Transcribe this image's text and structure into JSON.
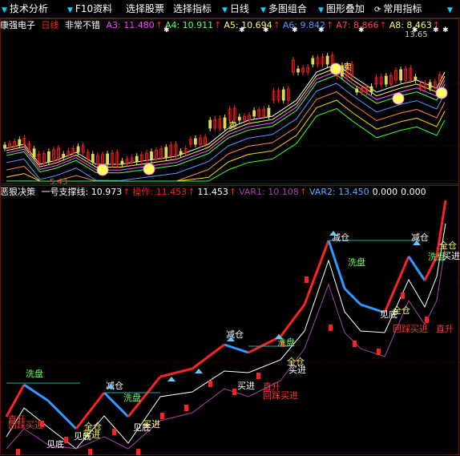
{
  "menubar": {
    "items": [
      {
        "label": "技术分析",
        "arrow": true
      },
      {
        "label": "F10资料",
        "arrow": true
      },
      {
        "label": "选择股票",
        "arrow": false
      },
      {
        "label": "选择指标",
        "arrow": false
      },
      {
        "label": "日线",
        "arrow": true
      },
      {
        "label": "多图组合",
        "arrow": true
      },
      {
        "label": "图形叠加",
        "arrow": true
      },
      {
        "label": "常用指标",
        "arrow": false,
        "icon": "refresh-icon"
      }
    ],
    "trailing_arrow": "▼"
  },
  "panel1": {
    "stock_name": "康强电子",
    "period": "日线",
    "comment": "非常不错",
    "indicators": [
      {
        "label": "A3: 11.480",
        "color": "#ff44ff"
      },
      {
        "label": "A4: 10.911",
        "color": "#66ff66"
      },
      {
        "label": "A5: 10.694",
        "color": "#ffff66"
      },
      {
        "label": "A6: 9.842",
        "color": "#5599ff"
      },
      {
        "label": "A7: 8.866",
        "color": "#ff4444"
      },
      {
        "label": "A8: 8.463",
        "color": "#ffff66"
      }
    ],
    "price_high": "13.65",
    "price_low": "5.43",
    "annotations": {
      "sell": "卖",
      "sell2": "卖"
    }
  },
  "panel2": {
    "name": "恶狠决策",
    "fields": [
      {
        "label": "一号支撑线: 10.973",
        "color": "#ffffff"
      },
      {
        "label": "操作: 11.453",
        "color": "#ff2222"
      },
      {
        "label": "11.453",
        "color": "#ffffff"
      },
      {
        "label": "VAR1: 10.108",
        "color": "#aa44aa"
      },
      {
        "label": "VAR2: 13.450",
        "color": "#66aaff"
      },
      {
        "label": "0.000",
        "color": "#ffffff"
      },
      {
        "label": "0.000",
        "color": "#ffffff"
      }
    ],
    "labels": {
      "xipan": "洗盘",
      "jiancang": "减仓",
      "jiandi": "见底",
      "quancang": "全仓",
      "mairu": "买进",
      "zhisheng": "直升",
      "huicai": "回踩买进",
      "quanmai": "全仓买进"
    }
  },
  "colors": {
    "candle_up": "#ff2222",
    "candle_down": "#00ffff",
    "ma_colors": [
      "#ffffff",
      "#ffff55",
      "#ff55ff",
      "#55ff55",
      "#5599ff",
      "#ff8844",
      "#ffdd00",
      "#33ff33"
    ]
  }
}
